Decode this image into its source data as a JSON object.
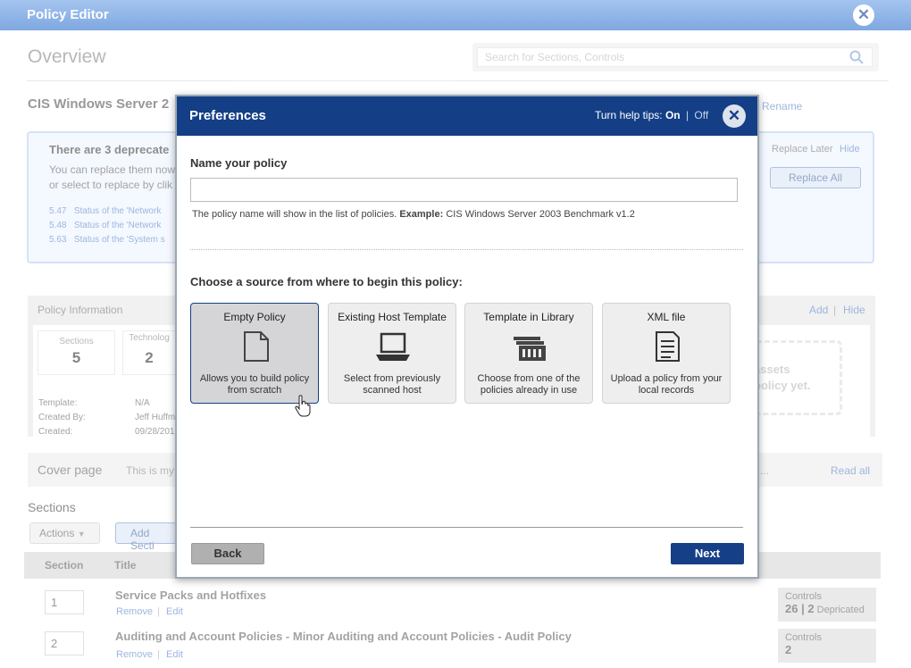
{
  "app": {
    "title": "Policy Editor"
  },
  "overview": {
    "title": "Overview",
    "search_placeholder": "Search for Sections, Controls",
    "policy_name": "CIS Windows Server 2",
    "rename": "Rename"
  },
  "warning": {
    "title": "There are 3 deprecate",
    "line1": "You can replace them now",
    "line2": "or select to replace by clik",
    "replace_later": "Replace Later",
    "hide": "Hide",
    "replace_all": "Replace All",
    "items": [
      {
        "num": "5.47",
        "text": "Status of the 'Network"
      },
      {
        "num": "5.48",
        "text": "Status of the 'Network"
      },
      {
        "num": "5.63",
        "text": "Status of the 'System s"
      }
    ]
  },
  "policy_info": {
    "title": "Policy Information",
    "add": "Add",
    "hide": "Hide",
    "sections_label": "Sections",
    "sections_value": "5",
    "technology_label": "Technolog",
    "technology_value": "2",
    "template_label": "Template:",
    "template_value": "N/A",
    "created_by_label": "Created By:",
    "created_by_value": "Jeff Huffm",
    "created_label": "Created:",
    "created_value": "09/28/201",
    "assets_text1": "assets",
    "assets_text2": "policy yet."
  },
  "cover": {
    "title": "Cover page",
    "text": "This is my",
    "ellipsis": "...",
    "read_all": "Read all"
  },
  "sections": {
    "title": "Sections",
    "actions": "Actions",
    "add_section": "Add Secti",
    "col_section": "Section",
    "col_title": "Title",
    "rows": [
      {
        "num": "1",
        "title": "Service Packs and Hotfixes",
        "remove": "Remove",
        "edit": "Edit",
        "controls_label": "Controls",
        "controls_value": "26 | 2",
        "deprecated": "Depricated"
      },
      {
        "num": "2",
        "title": "Auditing and Account Policies - Minor Auditing and Account Policies - Audit Policy",
        "remove": "Remove",
        "edit": "Edit",
        "controls_label": "Controls",
        "controls_value": "2",
        "deprecated": ""
      }
    ]
  },
  "modal": {
    "title": "Preferences",
    "help_tips_label": "Turn help tips:",
    "help_on": "On",
    "help_sep": "|",
    "help_off": "Off",
    "name_label": "Name your policy",
    "name_value": "",
    "hint_text": "The policy name will show in the list of policies.",
    "hint_example_label": "Example:",
    "hint_example": "CIS Windows Server 2003 Benchmark v1.2",
    "source_label": "Choose a source from where to begin this policy:",
    "sources": [
      {
        "title": "Empty Policy",
        "desc": "Allows you to build policy from scratch",
        "icon": "blank-document-icon",
        "selected": true
      },
      {
        "title": "Existing Host Template",
        "desc": "Select from previously scanned host",
        "icon": "laptop-icon",
        "selected": false
      },
      {
        "title": "Template in Library",
        "desc": "Choose from one of the policies already in use",
        "icon": "library-stack-icon",
        "selected": false
      },
      {
        "title": "XML file",
        "desc": "Upload a policy from your local records",
        "icon": "document-lines-icon",
        "selected": false
      }
    ],
    "back": "Back",
    "next": "Next"
  },
  "colors": {
    "header_blue": "#143f86",
    "titlebar": "#8fb3e6",
    "link": "#5b86c8"
  }
}
